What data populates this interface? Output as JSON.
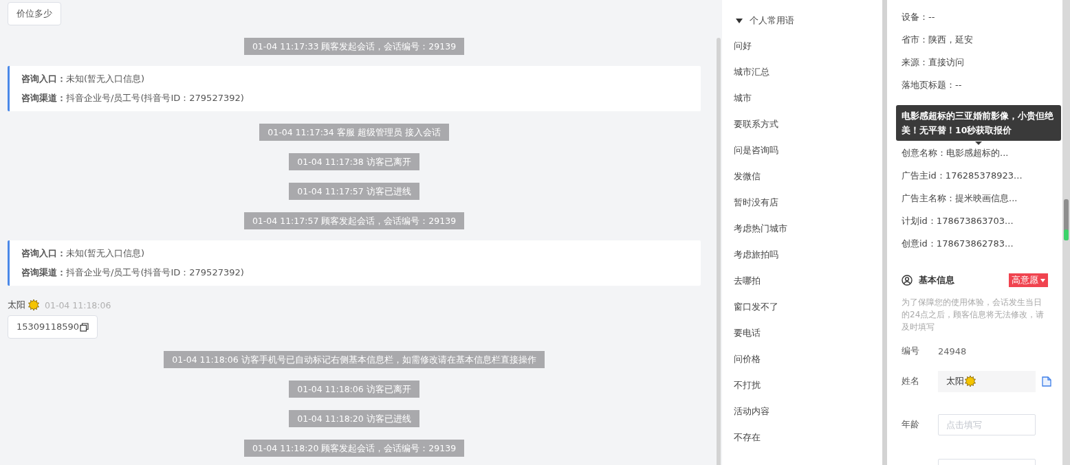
{
  "chat": {
    "messages": [
      {
        "kind": "bubble",
        "text": "价位多少"
      },
      {
        "kind": "system",
        "text": "01-04 11:17:33 顾客发起会话，会话编号：29139"
      },
      {
        "kind": "card",
        "lines": [
          {
            "label": "咨询入口：",
            "value": "未知(暂无入口信息)"
          },
          {
            "label": "咨询渠道：",
            "value": "抖音企业号/员工号(抖音号ID：279527392)"
          }
        ]
      },
      {
        "kind": "system",
        "text": "01-04 11:17:34 客服 超级管理员 接入会话"
      },
      {
        "kind": "system",
        "text": "01-04 11:17:38 访客已离开"
      },
      {
        "kind": "system",
        "text": "01-04 11:17:57 访客已进线"
      },
      {
        "kind": "system",
        "text": "01-04 11:17:57 顾客发起会话，会话编号：29139"
      },
      {
        "kind": "card",
        "lines": [
          {
            "label": "咨询入口：",
            "value": "未知(暂无入口信息)"
          },
          {
            "label": "咨询渠道：",
            "value": "抖音企业号/员工号(抖音号ID：279527392)"
          }
        ]
      },
      {
        "kind": "sender",
        "name": "太阳",
        "time": "01-04 11:18:06"
      },
      {
        "kind": "phone",
        "text": "15309118590"
      },
      {
        "kind": "system",
        "text": "01-04 11:18:06 访客手机号已自动标记右侧基本信息栏，如需修改请在基本信息栏直接操作"
      },
      {
        "kind": "system",
        "text": "01-04 11:18:06 访客已离开"
      },
      {
        "kind": "system",
        "text": "01-04 11:18:20 访客已进线"
      },
      {
        "kind": "system",
        "text": "01-04 11:18:20 顾客发起会话，会话编号：29139"
      }
    ]
  },
  "phrases": {
    "group": "个人常用语",
    "expanded": true,
    "items": [
      "问好",
      "城市汇总",
      "城市",
      "要联系方式",
      "问是咨询吗",
      "发微信",
      "暂时没有店",
      "考虑热门城市",
      "考虑旅拍吗",
      "去哪拍",
      "窗口发不了",
      "要电话",
      "问价格",
      "不打扰",
      "活动内容",
      "不存在"
    ]
  },
  "visitor": {
    "fields_top": [
      "设备：--",
      "省市：陕西，延安",
      "来源：直接访问",
      "落地页标题：--"
    ],
    "tooltip": "电影感超标的三亚婚前影像，小贵但绝美！无平替！10秒获取报价",
    "fields_bottom": [
      "创意名称：电影感超标的...",
      "广告主id：176285378923...",
      "广告主名称：提米映画信息...",
      "计划id：178673863703...",
      "创意id：178673862783..."
    ]
  },
  "basic_info": {
    "title": "基本信息",
    "intent": "高意愿",
    "note": "为了保障您的使用体验，会话发生当日的24点之后，顾客信息将无法修改，请及时填写",
    "id_label": "编号",
    "id_value": "24948",
    "name_label": "姓名",
    "name_value": "太阳",
    "age_label": "年龄",
    "age_placeholder": "点击填写"
  }
}
